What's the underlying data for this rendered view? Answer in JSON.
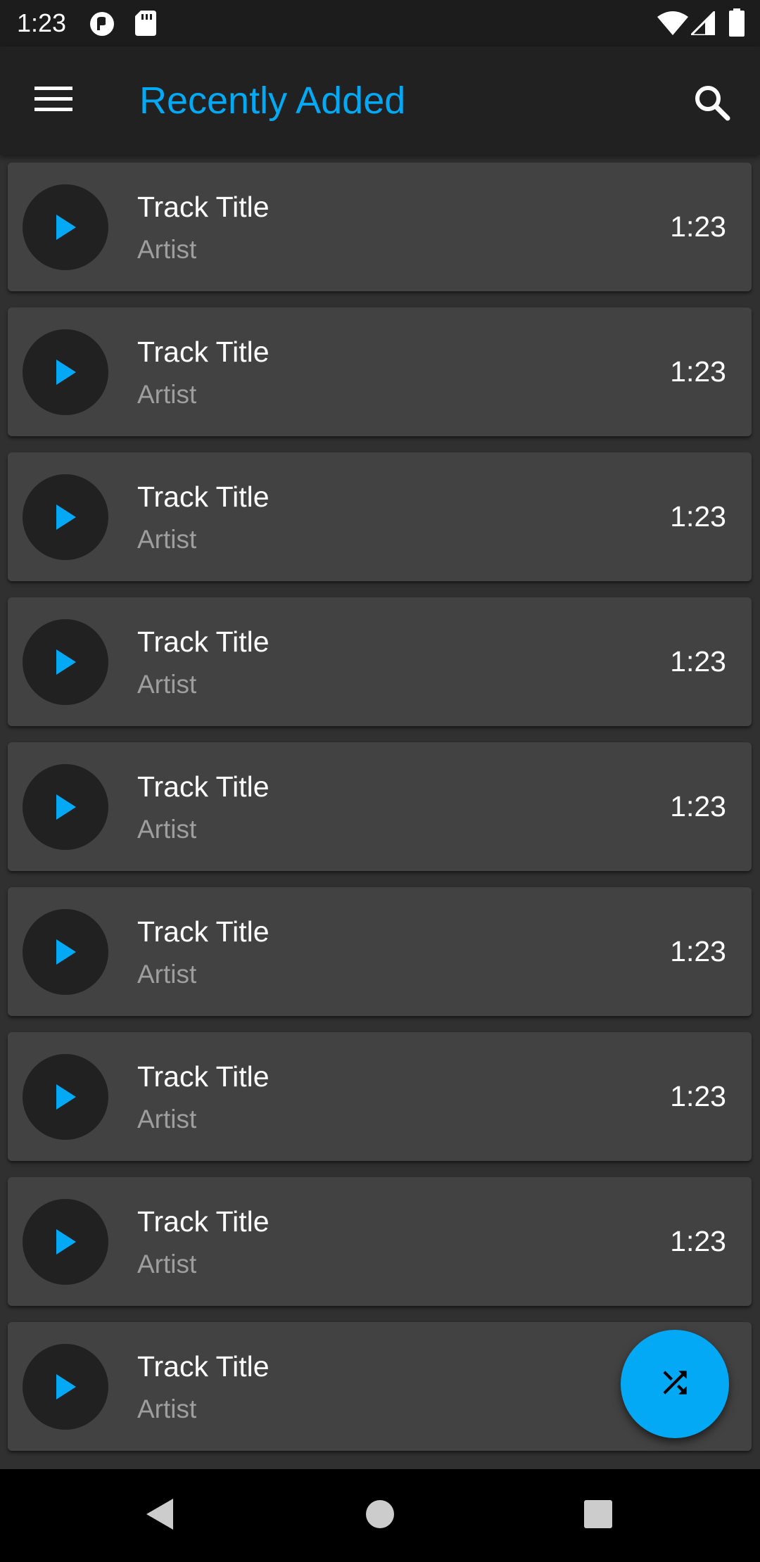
{
  "status_bar": {
    "time": "1:23",
    "icons": [
      "app-notification-icon",
      "sd-card-icon",
      "wifi-icon",
      "cellular-signal-icon",
      "battery-icon"
    ]
  },
  "app_bar": {
    "title": "Recently Added",
    "menu_icon": "hamburger-menu-icon",
    "search_icon": "search-icon"
  },
  "tracks": [
    {
      "title": "Track Title",
      "artist": "Artist",
      "duration": "1:23"
    },
    {
      "title": "Track Title",
      "artist": "Artist",
      "duration": "1:23"
    },
    {
      "title": "Track Title",
      "artist": "Artist",
      "duration": "1:23"
    },
    {
      "title": "Track Title",
      "artist": "Artist",
      "duration": "1:23"
    },
    {
      "title": "Track Title",
      "artist": "Artist",
      "duration": "1:23"
    },
    {
      "title": "Track Title",
      "artist": "Artist",
      "duration": "1:23"
    },
    {
      "title": "Track Title",
      "artist": "Artist",
      "duration": "1:23"
    },
    {
      "title": "Track Title",
      "artist": "Artist",
      "duration": "1:23"
    },
    {
      "title": "Track Title",
      "artist": "Artist",
      "duration": ""
    }
  ],
  "fab": {
    "icon": "shuffle-icon"
  },
  "nav_bar": {
    "icons": [
      "back-icon",
      "home-icon",
      "recents-icon"
    ]
  },
  "colors": {
    "accent": "#03a9f4",
    "background": "#303030",
    "card": "#424242",
    "app_bar": "#212121",
    "play_button_bg": "#212121",
    "primary_text": "#ffffff",
    "secondary_text": "#9e9e9e"
  }
}
